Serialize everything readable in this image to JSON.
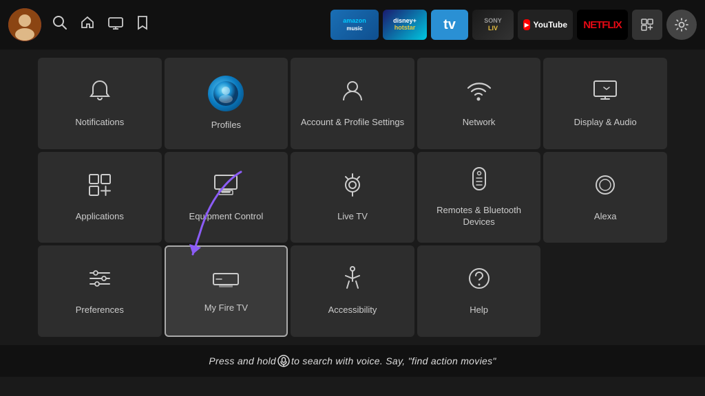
{
  "nav": {
    "avatar_emoji": "👤",
    "icons": [
      {
        "name": "search-icon",
        "symbol": "🔍"
      },
      {
        "name": "home-icon",
        "symbol": "⌂"
      },
      {
        "name": "tv-icon",
        "symbol": "📺"
      },
      {
        "name": "bookmark-icon",
        "symbol": "🔖"
      }
    ],
    "apps": [
      {
        "name": "amazon-music",
        "label": "amazon\nmusic"
      },
      {
        "name": "disney-hotstar",
        "label": "disney+\nhotstar"
      },
      {
        "name": "tv-app",
        "label": "tv"
      },
      {
        "name": "sony-liv",
        "label": "SONY\nLIV"
      },
      {
        "name": "youtube-app",
        "label": "YouTube"
      },
      {
        "name": "netflix-app",
        "label": "NETFLIX"
      },
      {
        "name": "grid-app",
        "label": "⊞"
      }
    ],
    "settings_label": "⚙"
  },
  "tiles": [
    {
      "id": "notifications",
      "label": "Notifications",
      "icon": "bell",
      "row": 1,
      "col": 1
    },
    {
      "id": "profiles",
      "label": "Profiles",
      "icon": "profile",
      "row": 1,
      "col": 2
    },
    {
      "id": "account-profile-settings",
      "label": "Account & Profile Settings",
      "icon": "person",
      "row": 1,
      "col": 3
    },
    {
      "id": "network",
      "label": "Network",
      "icon": "wifi",
      "row": 1,
      "col": 4
    },
    {
      "id": "display-audio",
      "label": "Display & Audio",
      "icon": "display",
      "row": 1,
      "col": 5
    },
    {
      "id": "applications",
      "label": "Applications",
      "icon": "apps",
      "row": 2,
      "col": 1
    },
    {
      "id": "equipment-control",
      "label": "Equipment Control",
      "icon": "tv",
      "row": 2,
      "col": 2
    },
    {
      "id": "live-tv",
      "label": "Live TV",
      "icon": "antenna",
      "row": 2,
      "col": 3
    },
    {
      "id": "remotes-bluetooth",
      "label": "Remotes & Bluetooth Devices",
      "icon": "remote",
      "row": 2,
      "col": 4
    },
    {
      "id": "alexa",
      "label": "Alexa",
      "icon": "alexa",
      "row": 2,
      "col": 5
    },
    {
      "id": "preferences",
      "label": "Preferences",
      "icon": "sliders",
      "row": 3,
      "col": 1
    },
    {
      "id": "my-fire-tv",
      "label": "My Fire TV",
      "icon": "firetv",
      "row": 3,
      "col": 2,
      "highlighted": true
    },
    {
      "id": "accessibility",
      "label": "Accessibility",
      "icon": "accessibility",
      "row": 3,
      "col": 3
    },
    {
      "id": "help",
      "label": "Help",
      "icon": "help",
      "row": 3,
      "col": 4
    }
  ],
  "bottom_bar": {
    "text_before_mic": "Press and hold ",
    "text_after_mic": " to search with voice. Say, \"find action movies\""
  }
}
